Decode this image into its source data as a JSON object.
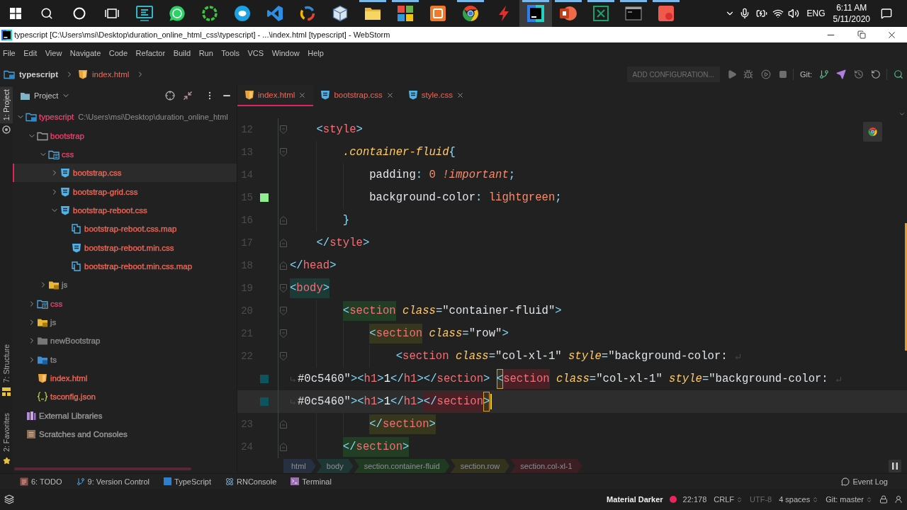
{
  "taskbar": {
    "apps": [
      {
        "running": false,
        "selected": false
      },
      {
        "running": false,
        "selected": false
      },
      {
        "running": false,
        "selected": false
      },
      {
        "running": false,
        "selected": false
      },
      {
        "running": false,
        "selected": false
      },
      {
        "running": false,
        "selected": false
      },
      {
        "running": false,
        "selected": false
      },
      {
        "running": true,
        "selected": false
      },
      {
        "running": true,
        "selected": false
      },
      {
        "running": false,
        "selected": false
      },
      {
        "running": true,
        "selected": false
      },
      {
        "running": false,
        "selected": false
      },
      {
        "running": true,
        "selected": true
      },
      {
        "running": true,
        "selected": false
      },
      {
        "running": true,
        "selected": false
      },
      {
        "running": true,
        "selected": false
      },
      {
        "running": true,
        "selected": false
      }
    ],
    "tray": {
      "language": "ENG",
      "time": "6:11 AM",
      "date": "5/11/2020"
    }
  },
  "window": {
    "title": "typescript [C:\\Users\\msi\\Desktop\\duration_online_html_css\\typescript] - ...\\index.html [typescript] - WebStorm"
  },
  "menu": [
    "File",
    "Edit",
    "View",
    "Navigate",
    "Code",
    "Refactor",
    "Build",
    "Run",
    "Tools",
    "VCS",
    "Window",
    "Help"
  ],
  "navigation_bar": {
    "breadcrumbs": [
      {
        "label": "typescript",
        "kind": "project"
      },
      {
        "label": "index.html",
        "kind": "html"
      }
    ],
    "run_configuration": "ADD CONFIGURATION...",
    "git_label": "Git:"
  },
  "tool_strip": {
    "top": [
      {
        "label": "1: Project",
        "kind": "project",
        "selected": true
      }
    ],
    "bottom": [
      {
        "label": "7: Structure",
        "kind": "structure",
        "selected": false
      },
      {
        "label": "2: Favorites",
        "kind": "favorites",
        "selected": false
      }
    ]
  },
  "project_panel": {
    "title": "Project",
    "tree": [
      {
        "label": "typescript",
        "path": "C:\\Users\\msi\\Desktop\\duration_online_html",
        "kind": "project",
        "color": "#e5416a",
        "expanded": true,
        "selected": false,
        "children": [
          {
            "label": "bootstrap",
            "kind": "folder",
            "color": "#e5416a",
            "expanded": true,
            "selected": false,
            "children": [
              {
                "label": "css",
                "kind": "css-folder",
                "color": "#e5416a",
                "expanded": true,
                "selected": false,
                "children": [
                  {
                    "label": "bootstrap.css",
                    "kind": "css",
                    "color": "#ed6757",
                    "expanded": false,
                    "selected": true
                  },
                  {
                    "label": "bootstrap-grid.css",
                    "kind": "css",
                    "color": "#ed6757",
                    "expanded": false,
                    "selected": false
                  },
                  {
                    "label": "bootstrap-reboot.css",
                    "kind": "css",
                    "color": "#ed6757",
                    "expanded": true,
                    "selected": false,
                    "children": [
                      {
                        "label": "bootstrap-reboot.css.map",
                        "kind": "map",
                        "color": "#ed6757",
                        "selected": false
                      },
                      {
                        "label": "bootstrap-reboot.min.css",
                        "kind": "css",
                        "color": "#ed6757",
                        "selected": false
                      },
                      {
                        "label": "bootstrap-reboot.min.css.map",
                        "kind": "map",
                        "color": "#ed6757",
                        "selected": false
                      }
                    ]
                  }
                ]
              },
              {
                "label": "js",
                "kind": "js-folder",
                "color": "#8a8a8a",
                "expanded": false,
                "selected": false
              }
            ]
          },
          {
            "label": "css",
            "kind": "css-folder",
            "color": "#e5416a",
            "expanded": false,
            "selected": false
          },
          {
            "label": "js",
            "kind": "js-folder",
            "color": "#8a8a8a",
            "expanded": false,
            "selected": false
          },
          {
            "label": "newBootstrap",
            "kind": "filled-folder",
            "color": "#8a8a8a",
            "expanded": false,
            "selected": false
          },
          {
            "label": "ts",
            "kind": "ts-folder",
            "color": "#8a8a8a",
            "expanded": false,
            "selected": false
          },
          {
            "label": "index.html",
            "kind": "html",
            "color": "#ed6757",
            "selected": false
          },
          {
            "label": "tsconfig.json",
            "kind": "json",
            "color": "#ed6757",
            "selected": false
          }
        ]
      },
      {
        "label": "External Libraries",
        "kind": "libraries",
        "color": "#9d9d9d",
        "selected": false
      },
      {
        "label": "Scratches and Consoles",
        "kind": "scratches",
        "color": "#9d9d9d",
        "selected": false
      }
    ]
  },
  "editor": {
    "tabs": [
      {
        "label": "index.html",
        "kind": "html",
        "selected": true
      },
      {
        "label": "bootstrap.css",
        "kind": "css",
        "selected": false
      },
      {
        "label": "style.css",
        "kind": "css",
        "selected": false
      }
    ],
    "lines": [
      {
        "number": "12",
        "kind": "fold-start",
        "current": false,
        "tokens": [
          {
            "text": "    <",
            "kind": "punct"
          },
          {
            "text": "style",
            "kind": "tag"
          },
          {
            "text": ">",
            "kind": "punct"
          }
        ]
      },
      {
        "number": "13",
        "kind": "fold-start",
        "current": false,
        "tokens": [
          {
            "text": "        .container-fluid",
            "kind": "selector"
          },
          {
            "text": "{",
            "kind": "punct"
          }
        ]
      },
      {
        "number": "14",
        "kind": "plain",
        "current": false,
        "tokens": [
          {
            "text": "            padding",
            "kind": "property"
          },
          {
            "text": ": ",
            "kind": "punct"
          },
          {
            "text": "0 ",
            "kind": "number"
          },
          {
            "text": "!important",
            "kind": "keyword"
          },
          {
            "text": ";",
            "kind": "punct"
          }
        ]
      },
      {
        "number": "15",
        "kind": "plain",
        "color": "#90ee90",
        "current": false,
        "tokens": [
          {
            "text": "            background-color",
            "kind": "property"
          },
          {
            "text": ": ",
            "kind": "punct"
          },
          {
            "text": "lightgreen",
            "kind": "value"
          },
          {
            "text": ";",
            "kind": "punct"
          }
        ]
      },
      {
        "number": "16",
        "kind": "fold-end",
        "current": false,
        "tokens": [
          {
            "text": "        }",
            "kind": "punct"
          }
        ]
      },
      {
        "number": "17",
        "kind": "fold-end",
        "current": false,
        "tokens": [
          {
            "text": "    </",
            "kind": "punct"
          },
          {
            "text": "style",
            "kind": "tag"
          },
          {
            "text": ">",
            "kind": "punct"
          }
        ]
      },
      {
        "number": "18",
        "kind": "fold-end",
        "current": false,
        "tokens": [
          {
            "text": "</",
            "kind": "punct"
          },
          {
            "text": "head",
            "kind": "tag"
          },
          {
            "text": ">",
            "kind": "punct"
          }
        ]
      },
      {
        "number": "19",
        "kind": "fold-start",
        "current": false,
        "tokens": [
          {
            "text": "<",
            "kind": "punct",
            "color": "#1d3a37"
          },
          {
            "text": "body",
            "kind": "tag",
            "color": "#1d3a37"
          },
          {
            "text": ">",
            "kind": "punct",
            "color": "#1d3a37"
          }
        ]
      },
      {
        "number": "20",
        "kind": "fold-start",
        "current": false,
        "tokens": [
          {
            "text": "        <",
            "kind": "punct",
            "color": "#223f25"
          },
          {
            "text": "section",
            "kind": "tag",
            "color": "#223f25"
          },
          {
            "text": " class",
            "kind": "attr"
          },
          {
            "text": "=",
            "kind": "punct"
          },
          {
            "text": "\"container-fluid\"",
            "kind": "string"
          },
          {
            "text": ">",
            "kind": "punct"
          }
        ]
      },
      {
        "number": "21",
        "kind": "fold-start",
        "current": false,
        "tokens": [
          {
            "text": "            <",
            "kind": "punct",
            "color": "#37371e"
          },
          {
            "text": "section",
            "kind": "tag",
            "color": "#37371e"
          },
          {
            "text": " class",
            "kind": "attr"
          },
          {
            "text": "=",
            "kind": "punct"
          },
          {
            "text": "\"row\"",
            "kind": "string"
          },
          {
            "text": ">",
            "kind": "punct"
          }
        ]
      },
      {
        "number": "22",
        "kind": "fold-start",
        "current": false,
        "tokens": [
          {
            "text": "                <",
            "kind": "punct"
          },
          {
            "text": "section",
            "kind": "tag"
          },
          {
            "text": " class",
            "kind": "attr"
          },
          {
            "text": "=",
            "kind": "punct"
          },
          {
            "text": "\"col-xl-1\"",
            "kind": "string"
          },
          {
            "text": " style",
            "kind": "attr"
          },
          {
            "text": "=",
            "kind": "punct"
          },
          {
            "text": "\"background-color:",
            "kind": "string"
          }
        ],
        "continuations": [
          {
            "color": "#0c5460",
            "current": false,
            "tokens": [
              {
                "text": "#0c5460\"",
                "kind": "string"
              },
              {
                "text": "><",
                "kind": "punct"
              },
              {
                "text": "h1",
                "kind": "tag"
              },
              {
                "text": ">",
                "kind": "punct"
              },
              {
                "text": "1",
                "kind": "text"
              },
              {
                "text": "</",
                "kind": "punct"
              },
              {
                "text": "h1",
                "kind": "tag"
              },
              {
                "text": "></",
                "kind": "punct"
              },
              {
                "text": "section",
                "kind": "tag"
              },
              {
                "text": "> ",
                "kind": "punct"
              },
              {
                "text": "<",
                "kind": "matched-punct"
              },
              {
                "text": "section",
                "kind": "tag",
                "color": "#4a2027"
              },
              {
                "text": " class",
                "kind": "attr"
              },
              {
                "text": "=",
                "kind": "punct"
              },
              {
                "text": "\"col-xl-1\"",
                "kind": "string"
              },
              {
                "text": " style",
                "kind": "attr"
              },
              {
                "text": "=",
                "kind": "punct"
              },
              {
                "text": "\"background-color:",
                "kind": "string"
              }
            ]
          },
          {
            "color": "#0c5460",
            "current": true,
            "tokens": [
              {
                "text": "#0c5460\"",
                "kind": "string"
              },
              {
                "text": "><",
                "kind": "punct"
              },
              {
                "text": "h1",
                "kind": "tag"
              },
              {
                "text": ">",
                "kind": "punct"
              },
              {
                "text": "1",
                "kind": "text"
              },
              {
                "text": "</",
                "kind": "punct"
              },
              {
                "text": "h1",
                "kind": "tag"
              },
              {
                "text": ">",
                "kind": "punct"
              },
              {
                "text": "</",
                "kind": "punct",
                "color": "#4a2027"
              },
              {
                "text": "section",
                "kind": "tag",
                "color": "#4a2027"
              },
              {
                "text": ">",
                "kind": "matched-punct"
              }
            ]
          }
        ]
      },
      {
        "number": "23",
        "kind": "fold-end",
        "current": false,
        "tokens": [
          {
            "text": "            </",
            "kind": "punct",
            "color": "#37371e"
          },
          {
            "text": "section",
            "kind": "tag",
            "color": "#37371e"
          },
          {
            "text": ">",
            "kind": "punct",
            "color": "#37371e"
          }
        ]
      },
      {
        "number": "24",
        "kind": "fold-end",
        "current": false,
        "tokens": [
          {
            "text": "        </",
            "kind": "punct",
            "color": "#223f25"
          },
          {
            "text": "section",
            "kind": "tag",
            "color": "#223f25"
          },
          {
            "text": ">",
            "kind": "punct",
            "color": "#223f25"
          }
        ]
      }
    ],
    "breadcrumbs": [
      {
        "label": "html",
        "color": "#263040"
      },
      {
        "label": "body",
        "color": "#1e3634"
      },
      {
        "label": "section.container-fluid",
        "color": "#1f3a21"
      },
      {
        "label": "section.row",
        "color": "#33331d"
      },
      {
        "label": "section.col-xl-1",
        "color": "#3d1e22"
      }
    ]
  },
  "tool_window_bar": {
    "items": [
      {
        "label": "6: TODO",
        "kind": "todo"
      },
      {
        "label": "9: Version Control",
        "kind": "vcs"
      },
      {
        "label": "TypeScript",
        "kind": "typescript"
      },
      {
        "label": "RNConsole",
        "kind": "console"
      },
      {
        "label": "Terminal",
        "kind": "terminal"
      }
    ],
    "event_log": "Event Log"
  },
  "status_bar": {
    "theme": "Material Darker",
    "position": "22:178",
    "line_separator": "CRLF",
    "encoding": "UTF-8",
    "indent": "4 spaces",
    "vcs_branch": "Git: master"
  }
}
